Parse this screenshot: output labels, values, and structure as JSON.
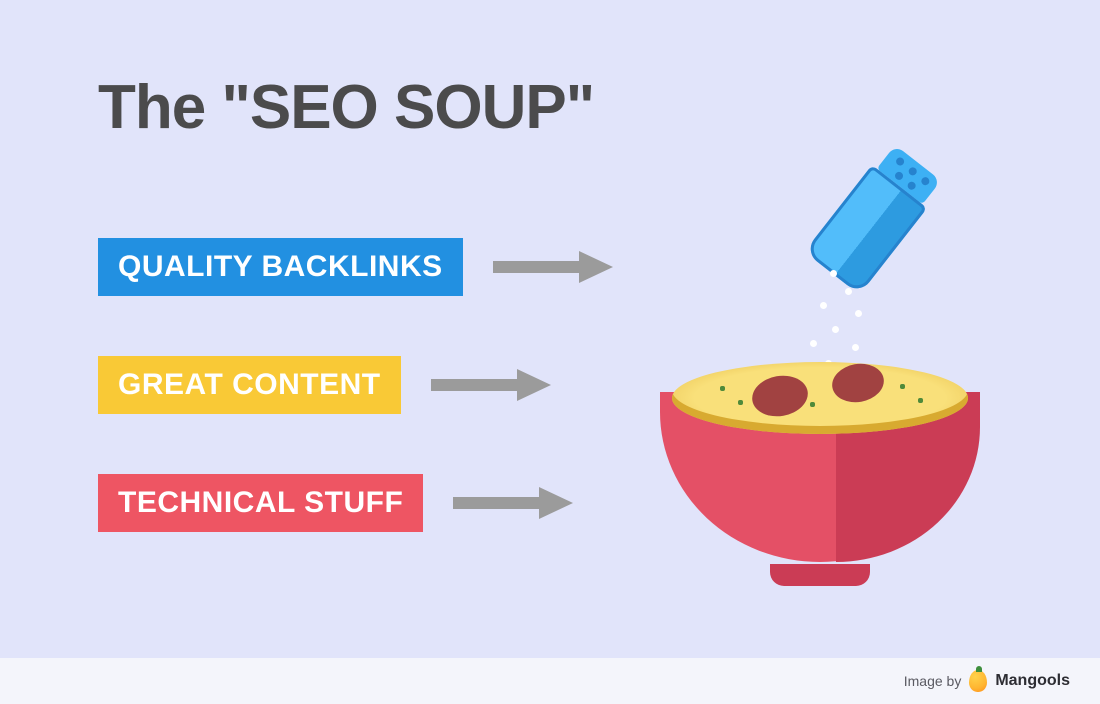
{
  "title": "The \"SEO SOUP\"",
  "labels": {
    "backlinks": "QUALITY BACKLINKS",
    "content": "GREAT CONTENT",
    "technical": "TECHNICAL STUFF"
  },
  "colors": {
    "bg": "#E1E4FA",
    "title": "#4B4B4C",
    "label_blue": "#2290E1",
    "label_yellow": "#F9C936",
    "label_red": "#EE5563",
    "arrow": "#9B9B9B",
    "bowl_outer": "#E45066",
    "bowl_shadow": "#CB3C55",
    "soup": "#F9E07A",
    "meat": "#A14241",
    "shaker_light": "#52BDFA",
    "shaker_dark": "#2D9BE0"
  },
  "illustration": {
    "shaker": "salt-shaker",
    "bowl": "soup-bowl"
  },
  "footer": {
    "prefix": "Image by",
    "brand": "Mangools"
  }
}
